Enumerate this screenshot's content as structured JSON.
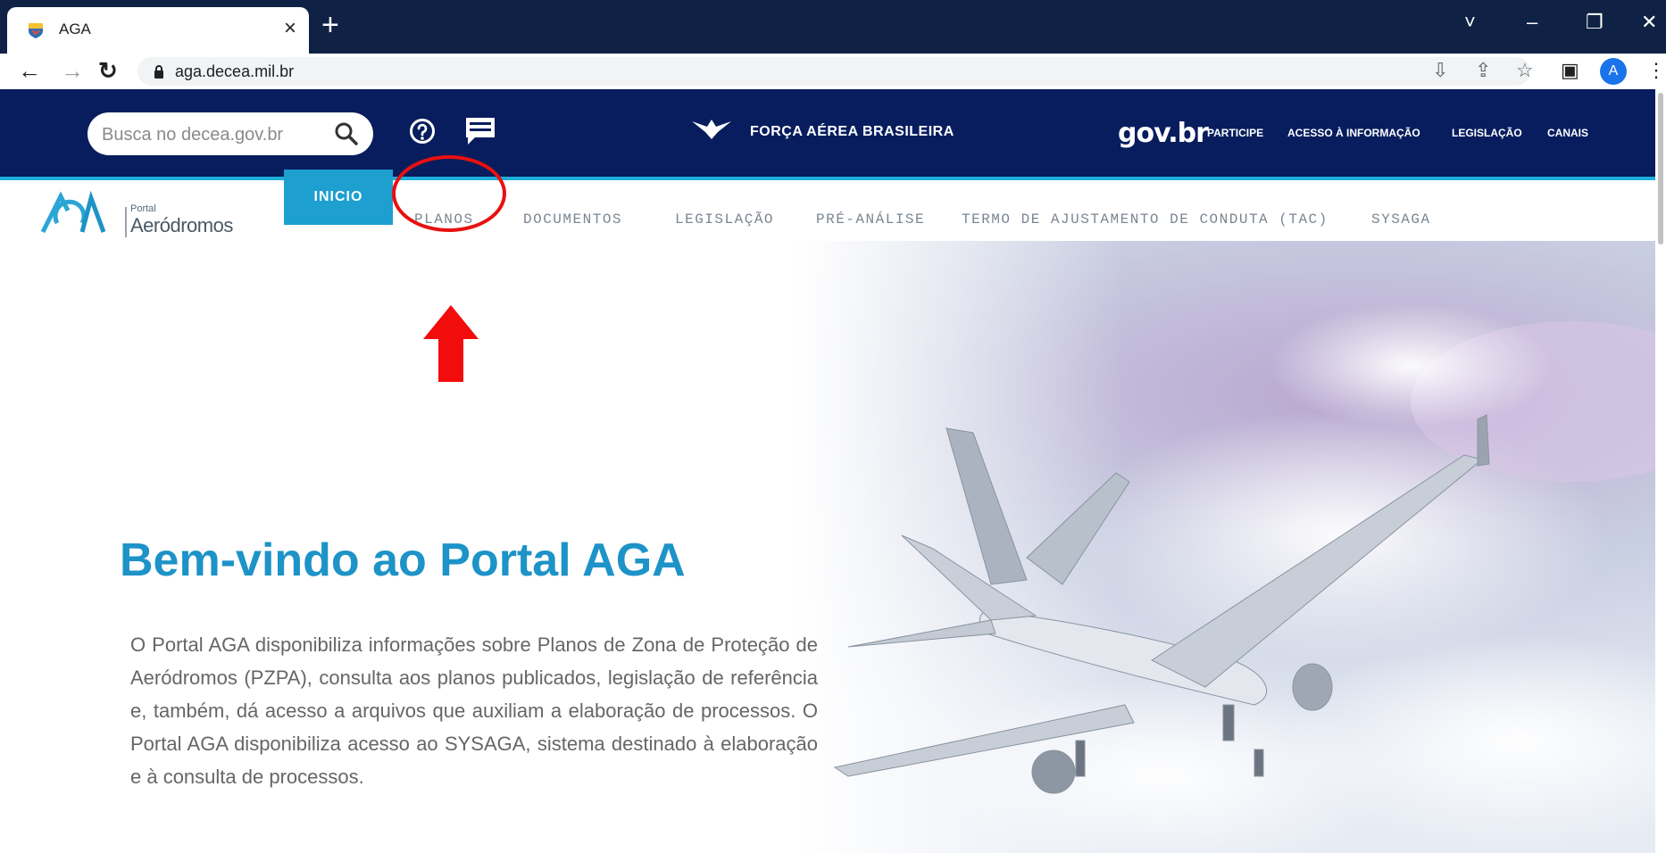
{
  "browser": {
    "tab_title": "AGA",
    "tab_close": "×",
    "new_tab": "+",
    "url": "aga.decea.mil.br",
    "window_controls": [
      "˅",
      "–",
      "❐",
      "✕"
    ],
    "profile_initial": "A"
  },
  "header": {
    "search_placeholder": "Busca no decea.gov.br",
    "fab_title": "FORÇA AÉREA BRASILEIRA",
    "govbr": "gov.br",
    "links": [
      "PARTICIPE",
      "ACESSO À INFORMAÇÃO",
      "LEGISLAÇÃO",
      "CANAIS"
    ]
  },
  "logo": {
    "portal": "Portal",
    "name": "Aeródromos"
  },
  "nav": {
    "items": [
      "INICIO",
      "PLANOS",
      "DOCUMENTOS",
      "LEGISLAÇÃO",
      "PRÉ-ANÁLISE",
      "TERMO DE AJUSTAMENTO DE CONDUTA (TAC)",
      "SYSAGA"
    ],
    "active": "INICIO"
  },
  "hero": {
    "title": "Bem-vindo ao Portal AGA",
    "text": "O Portal AGA disponibiliza informações sobre Planos de Zona de Proteção de Aeródromos (PZPA), consulta aos planos publicados, legislação de referência e, também, dá acesso a arquivos que auxiliam a elaboração de processos. O Portal AGA disponibiliza acesso ao SYSAGA, sistema destinado à elaboração e à consulta de processos."
  },
  "colors": {
    "header_bg": "#071d5e",
    "accent": "#1d9fd0",
    "title": "#1d93c7",
    "annotation": "#e81010"
  }
}
